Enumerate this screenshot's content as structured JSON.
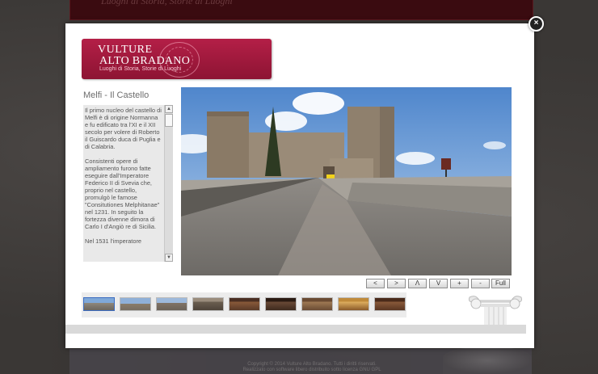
{
  "background": {
    "header_text": "Luoghi di Storia, Storie di Luoghi",
    "footer_line1": "Copyright © 2014 Vulture Alto Bradano. Tutti i diritti riservati.",
    "footer_line2": "Realizzato con software libero distribuito sotto licenza GNU GPL"
  },
  "modal": {
    "close_label": "×",
    "logo": {
      "line1": "VULTURE",
      "line2": "ALTO BRADANO",
      "tagline": "Luoghi di Storia, Storie di Luoghi"
    },
    "title": "Melfi - Il Castello",
    "description": {
      "p1": "Il primo nucleo del castello di Melfi è di origine Normanna e fu edificato tra l'XI e il XII secolo per volere di Roberto il Guiscardo duca di Puglia e di Calabria.",
      "p2": "Consistenti opere di ampliamento furono fatte eseguire dall'Imperatore Federico II di Svevia che, proprio nel castello, promulgò le famose \"Consitutiones Melphitanae\" nel 1231. In seguito la fortezza divenne dimora di Carlo I d'Angiò re di Sicilia.",
      "p3": "Nel 1531 l'imperatore"
    },
    "controls": {
      "left": "<",
      "right": ">",
      "up": "Λ",
      "down": "V",
      "zoom_in": "+",
      "zoom_out": "-",
      "fullscreen": "Full"
    },
    "thumbnails": [
      "thumb-1",
      "thumb-2",
      "thumb-3",
      "thumb-4",
      "thumb-5",
      "thumb-6",
      "thumb-7",
      "thumb-8",
      "thumb-9"
    ],
    "selected_thumbnail": 1
  },
  "icons": {
    "close": "close-icon",
    "scroll_up": "scroll-up-icon",
    "scroll_down": "scroll-down-icon",
    "column": "ionic-column-icon"
  },
  "colors": {
    "brand": "#a3193e",
    "background": "#3a3735"
  }
}
